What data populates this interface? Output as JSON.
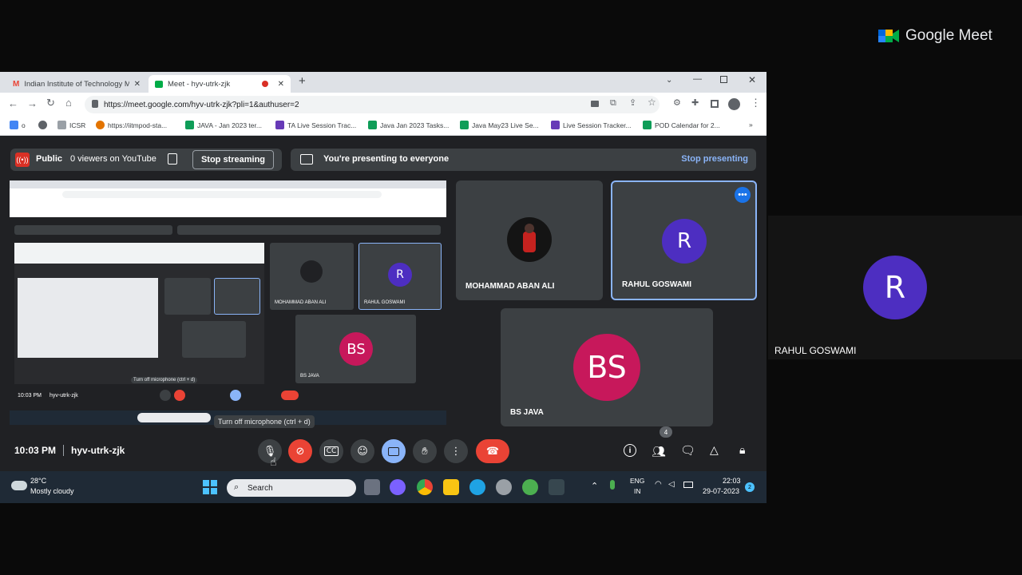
{
  "brand": {
    "name": "Google Meet"
  },
  "browser": {
    "tabs": [
      {
        "label": "Indian Institute of Technology M"
      },
      {
        "label": "Meet - hyv-utrk-zjk"
      }
    ],
    "url": "https://meet.google.com/hyv-utrk-zjk?pli=1&authuser=2",
    "bookmarks": [
      {
        "label": "o"
      },
      {
        "label": "ICSR"
      },
      {
        "label": "https://iitmpod-sta..."
      },
      {
        "label": "JAVA - Jan 2023 ter..."
      },
      {
        "label": "TA Live Session Trac..."
      },
      {
        "label": "Java Jan 2023 Tasks..."
      },
      {
        "label": "Java May23 Live Se..."
      },
      {
        "label": "Live Session Tracker..."
      },
      {
        "label": "POD Calendar for 2..."
      }
    ]
  },
  "stream": {
    "visibility": "Public",
    "viewers": "0 viewers on YouTube",
    "stop_streaming": "Stop streaming"
  },
  "presenting": {
    "message": "You're presenting to everyone",
    "stop_presenting": "Stop presenting"
  },
  "participants": {
    "mohammad": "MOHAMMAD ABAN ALI",
    "rahul": "RAHUL GOSWAMI",
    "rahul_initial": "R",
    "bs": "BS JAVA",
    "bs_initials": "BS"
  },
  "meeting": {
    "time": "10:03 PM",
    "code": "hyv-utrk-zjk",
    "participant_count": "4",
    "mic_tooltip": "Turn off microphone (ctrl + d)"
  },
  "taskbar": {
    "temperature": "28°C",
    "weather": "Mostly cloudy",
    "search": "Search",
    "lang": "ENG",
    "region": "IN",
    "clock_time": "22:03",
    "clock_date": "29-07-2023"
  },
  "colors": {
    "rahul_avatar": "#4d2ec1",
    "bs_avatar": "#c7185b",
    "end_call": "#ea4335",
    "accent": "#8ab4f8"
  }
}
